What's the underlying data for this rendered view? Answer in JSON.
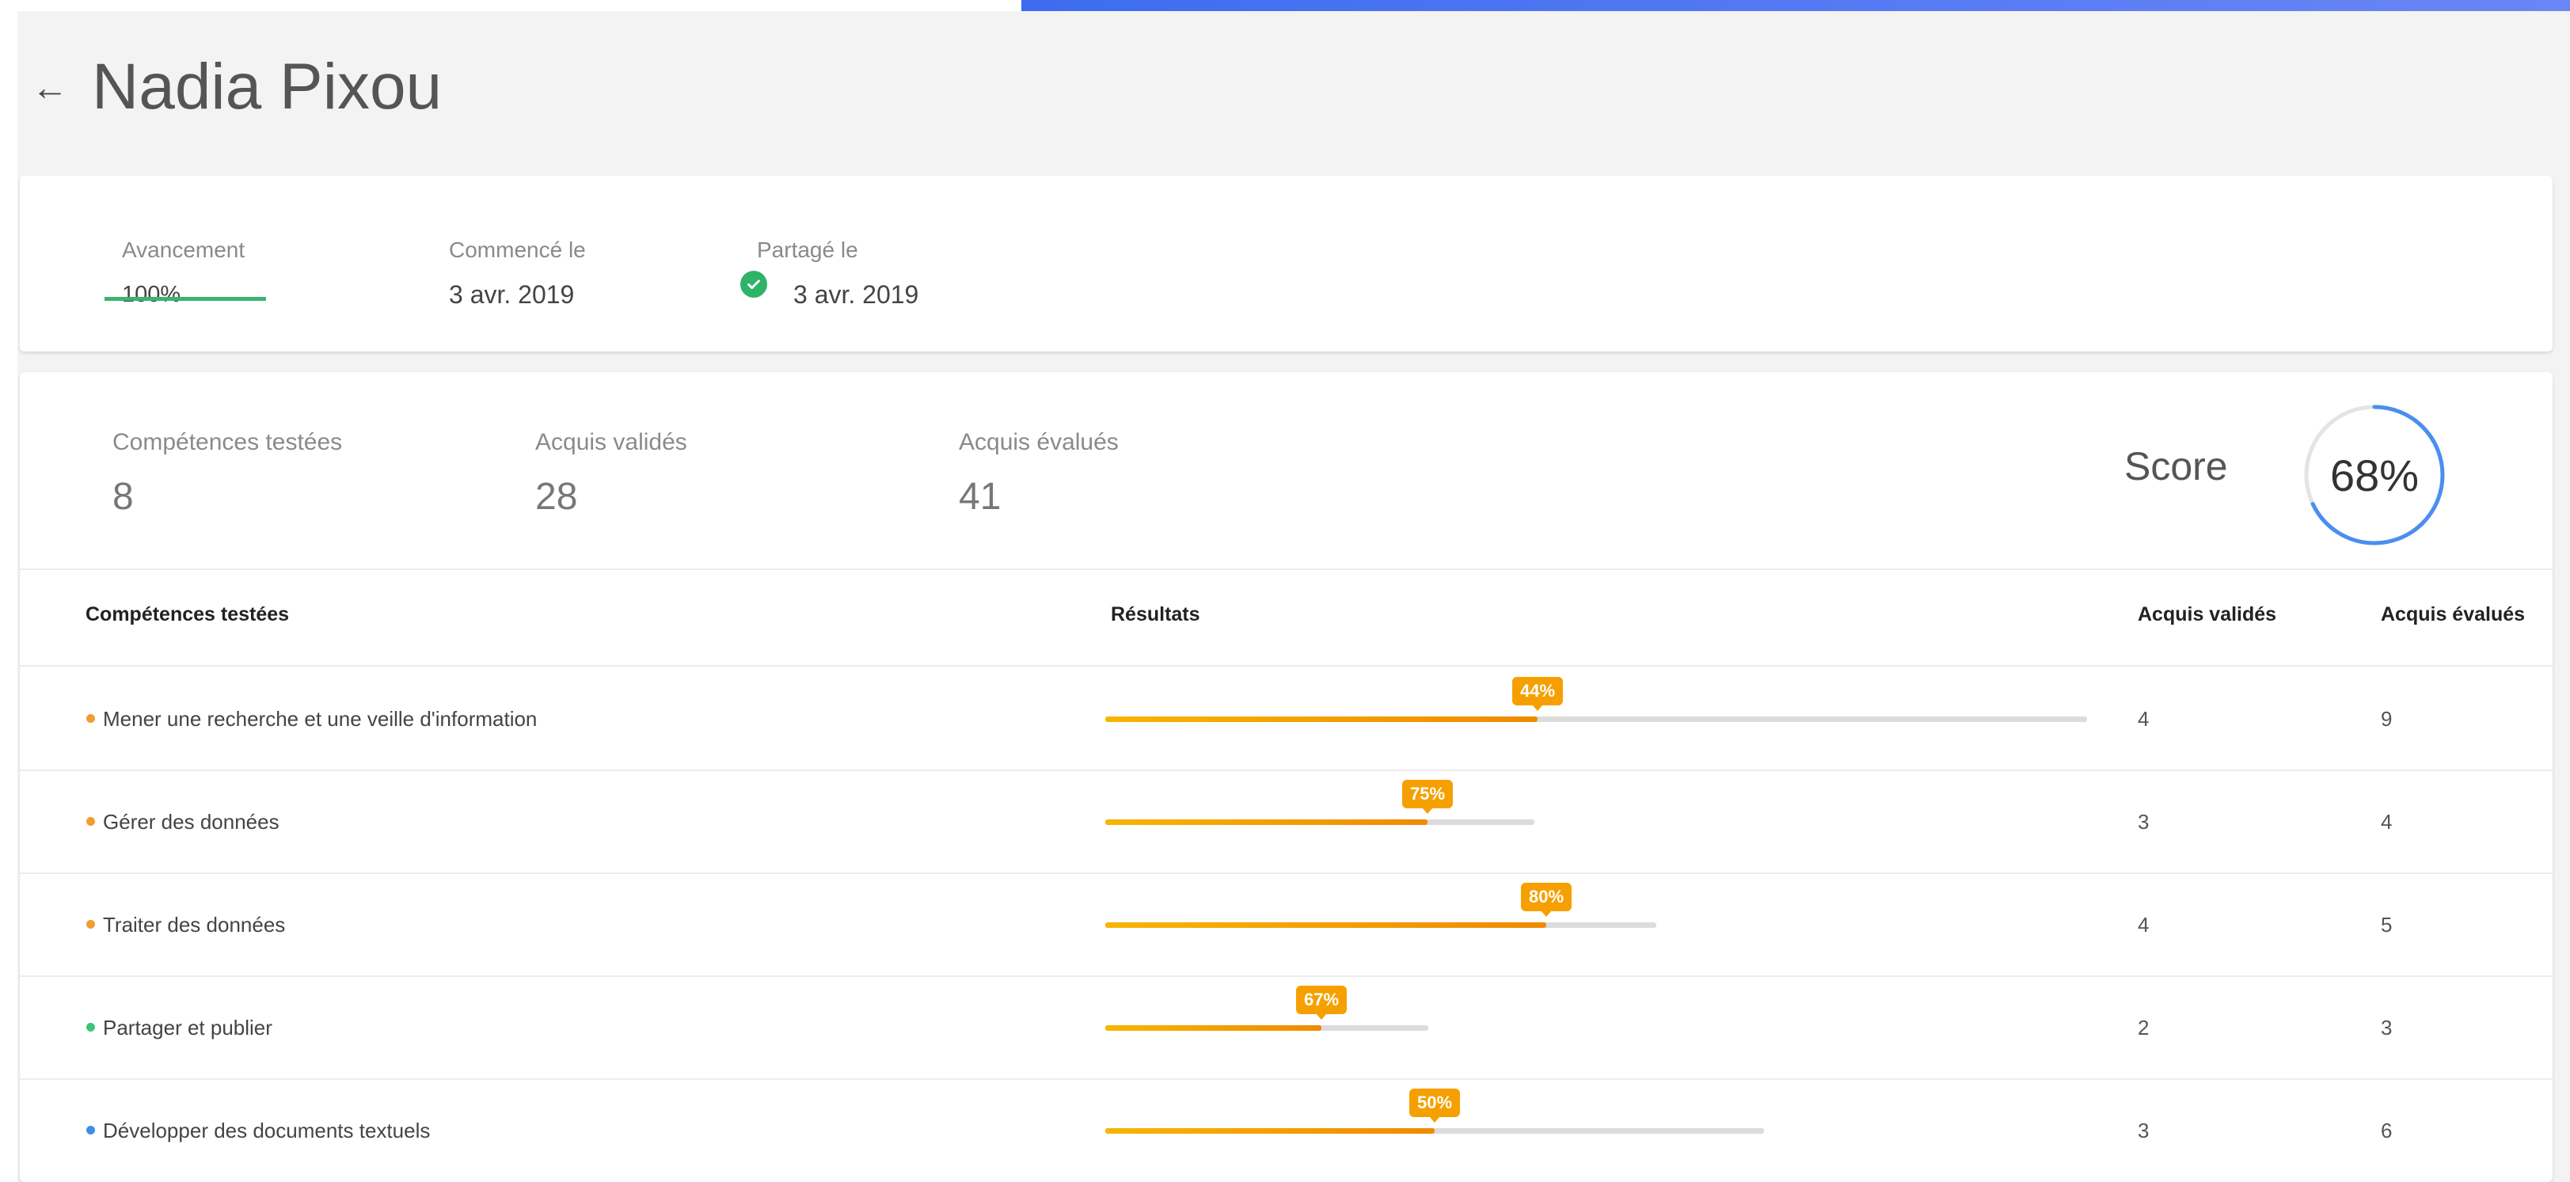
{
  "header": {
    "title": "Nadia Pixou",
    "back_icon": "arrow-left-icon"
  },
  "summary": {
    "progress_label": "Avancement",
    "progress_value": "100%",
    "progress_fraction": 1.0,
    "started_label": "Commencé le",
    "started_value": "3 avr. 2019",
    "shared_label": "Partagé le",
    "shared_value": "3 avr. 2019",
    "shared_icon": "check-circle-icon"
  },
  "stats": {
    "tested_label": "Compétences testées",
    "tested_value": "8",
    "validated_label": "Acquis validés",
    "validated_value": "28",
    "evaluated_label": "Acquis évalués",
    "evaluated_value": "41",
    "score_label": "Score",
    "score_value": "68%",
    "score_fraction": 0.68
  },
  "table": {
    "headers": [
      "Compétences testées",
      "Résultats",
      "Acquis validés",
      "Acquis évalués"
    ],
    "rows": [
      {
        "name": "Mener une recherche et une veille d'information",
        "percent": "44%",
        "fill": 0.44,
        "validated": "4",
        "evaluated": "9",
        "dot_color": "#f39c32"
      },
      {
        "name": "Gérer des données",
        "percent": "75%",
        "fill": 0.75,
        "validated": "3",
        "evaluated": "4",
        "dot_color": "#f39c32"
      },
      {
        "name": "Traiter des données",
        "percent": "80%",
        "fill": 0.8,
        "validated": "4",
        "evaluated": "5",
        "dot_color": "#f39c32"
      },
      {
        "name": "Partager et publier",
        "percent": "67%",
        "fill": 0.67,
        "validated": "2",
        "evaluated": "3",
        "dot_color": "#3cc47c"
      },
      {
        "name": "Développer des documents textuels",
        "percent": "50%",
        "fill": 0.5,
        "validated": "3",
        "evaluated": "6",
        "dot_color": "#3a8ee6"
      }
    ]
  },
  "colors": {
    "accent_blue": "#3d6cf0",
    "progress_green": "#3cb371",
    "bar_orange": "#f5a000",
    "score_ring": "#4a8ef0"
  }
}
